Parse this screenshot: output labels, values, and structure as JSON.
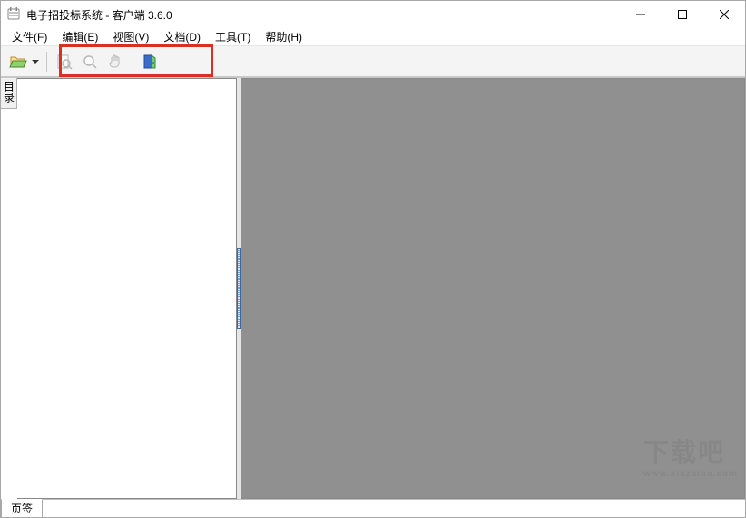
{
  "title": "电子招投标系统 - 客户端 3.6.0",
  "menus": {
    "file": "文件(F)",
    "edit": "编辑(E)",
    "view": "视图(V)",
    "doc": "文档(D)",
    "tool": "工具(T)",
    "help": "帮助(H)"
  },
  "sidebar": {
    "tab_label": "目录"
  },
  "bottom": {
    "tab_label": "页签"
  },
  "watermark": {
    "main": "下载吧",
    "sub": "www.xiazaiba.com"
  }
}
